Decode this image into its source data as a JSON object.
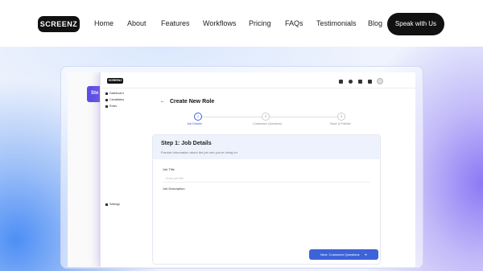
{
  "nav": {
    "logo": "SCREENZ",
    "links": [
      "Home",
      "About",
      "Features",
      "Workflows",
      "Pricing",
      "FAQs",
      "Testimonials",
      "Blog"
    ],
    "cta": "Speak with Us"
  },
  "preview": {
    "back_chip": "Ste",
    "app_logo": "SCREENZ",
    "sidebar": [
      "Dashboard",
      "Candidates",
      "Roles"
    ],
    "settings": "Settings",
    "back_icon": "←",
    "page_title": "Create New Role",
    "steps": [
      {
        "num": "1",
        "label": "Job Details"
      },
      {
        "num": "2",
        "label": "Customize Questions"
      },
      {
        "num": "3",
        "label": "Save & Publish"
      }
    ],
    "card_title": "Step 1: Job Details",
    "card_subtitle": "Provide information about the job role you're hiring for",
    "job_title_label": "Job Title",
    "job_title_placeholder": "Enter job title",
    "job_description_label": "Job Description",
    "next_button": "Next: Customize Questions",
    "next_arrow": "➜"
  },
  "colors": {
    "accent": "#3d63d8",
    "brand_dark": "#111111",
    "purple": "#5b4fe6"
  }
}
